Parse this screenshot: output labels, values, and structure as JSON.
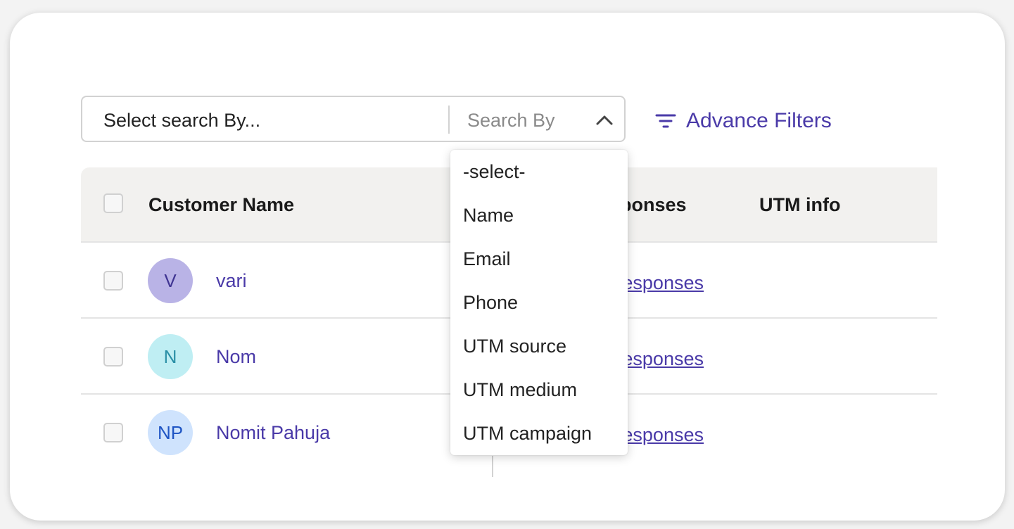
{
  "search": {
    "placeholder": "Select search By...",
    "search_by_label": "Search By"
  },
  "filters": {
    "advance_label": "Advance Filters"
  },
  "table": {
    "headers": {
      "customer_name": "Customer Name",
      "responses_partial": "ponses",
      "utm_info": "UTM info"
    },
    "rows": [
      {
        "initials": "V",
        "name": "vari",
        "responses_link": "Responses",
        "avatar_bg": "#b9b3e6",
        "avatar_fg": "#3f3492"
      },
      {
        "initials": "N",
        "name": "Nom",
        "responses_link": "Responses",
        "avatar_bg": "#bfeef3",
        "avatar_fg": "#2a8fa6"
      },
      {
        "initials": "NP",
        "name": "Nomit Pahuja",
        "responses_link": "Responses",
        "avatar_bg": "#cfe3fd",
        "avatar_fg": "#1f55c4"
      }
    ]
  },
  "dropdown": {
    "options": [
      "-select-",
      "Name",
      "Email",
      "Phone",
      "UTM source",
      "UTM medium",
      "UTM campaign"
    ]
  },
  "colors": {
    "accent": "#4a3aa8",
    "header_bg": "#f2f1ef"
  },
  "icons": {
    "chevron": "chevron-up-icon",
    "filter": "filter-icon"
  }
}
